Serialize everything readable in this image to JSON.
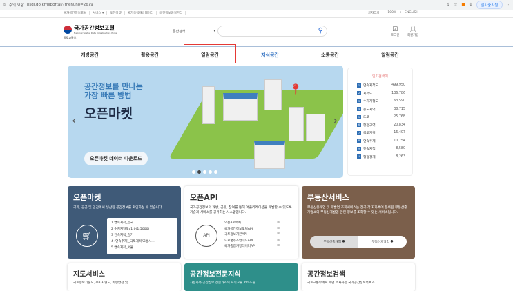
{
  "browser": {
    "security": "주의 요함",
    "url": "nsdi.go.kr/lxportal/?menuno=2679",
    "sync": "일시중지됨"
  },
  "util": {
    "links": [
      "국가공간정보포털",
      "서비스 ▾",
      "오픈마켓",
      "국가중점개방데이터",
      "공간정보품질관리"
    ],
    "font": "글자크기",
    "minus": "−",
    "zoom": "100%",
    "plus": "+",
    "english": "ENGLISH"
  },
  "header": {
    "logo_title": "국가공간정보포털",
    "logo_sub": "National Spatial Data Infrastructure Portal",
    "ministry": "국토교통부",
    "search_select": "통합검색",
    "search_placeholder": "",
    "login": "로그인",
    "signup": "회원가입"
  },
  "nav": [
    "개방공간",
    "활용공간",
    "열람공간",
    "지식공간",
    "소통공간",
    "알림공간"
  ],
  "banner": {
    "line1": "공간정보를 만나는",
    "line2": "가장 빠른 방법",
    "title": "오픈마켓",
    "button": "오픈마켓 데이터 다운로드",
    "slides": 5,
    "active_slide": 2
  },
  "popular": {
    "title": "인기검색어",
    "items": [
      {
        "rank": "1",
        "name": "연속지적도",
        "count": "499,950"
      },
      {
        "rank": "2",
        "name": "지적도",
        "count": "136,786"
      },
      {
        "rank": "3",
        "name": "수치지형도",
        "count": "63,590"
      },
      {
        "rank": "4",
        "name": "용도지역",
        "count": "38,715"
      },
      {
        "rank": "5",
        "name": "도로",
        "count": "25,768"
      },
      {
        "rank": "6",
        "name": "행정구역",
        "count": "20,834"
      },
      {
        "rank": "7",
        "name": "국토계획",
        "count": "16,407"
      },
      {
        "rank": "8",
        "name": "연속주제",
        "count": "10,754"
      },
      {
        "rank": "9",
        "name": "연속지적",
        "count": "8,580"
      },
      {
        "rank": "10",
        "name": "행정경계",
        "count": "8,263"
      }
    ]
  },
  "openmarket": {
    "title": "오픈마켓",
    "desc": "국가, 공공 및 민간에서 생산된 공간정보를 확인하실 수 있습니다.",
    "items": [
      "1  연속지적_전국",
      "2  수치지형도v1.0(1:5000)",
      "3  연속지적_경기",
      "4  (연속주제)_국토계획/교통시...",
      "5  연속지적_서울"
    ]
  },
  "openapi": {
    "title": "오픈API",
    "desc": "국가공간정보의 개방, 공유, 참여를 통해 어플리케이션을 개발할 수 있도록 기술과 서비스를 공유하는 시스템입니다.",
    "icon": "API",
    "items": [
      "오픈API목록",
      "국가공간정보포털API",
      "국토정보기본API",
      "도로명주소안내도API",
      "국가중점개방데이터API"
    ]
  },
  "realestate": {
    "title": "부동산서비스",
    "desc": "부동산중개업 및 개발업 조회서비스는 전국 각 지자체에 등록된 부동산중개업소와 부동산개발업 관련 정보를 조회할 수 있는 서비스입니다.",
    "btn1": "부동산중개업",
    "btn2": "부동산개발업"
  },
  "mapservice": {
    "title": "지도서비스",
    "desc": "국토정보기본도, 수치지형도, 비행안전 및"
  },
  "expert": {
    "title": "공간정보전문지식",
    "desc": "사용자와 공간정보 전문가와의 지식교류 서비스를"
  },
  "search": {
    "title": "공간정보검색",
    "desc": "국토교통부에서 매년 조사하는 국가공간정보목록과"
  }
}
